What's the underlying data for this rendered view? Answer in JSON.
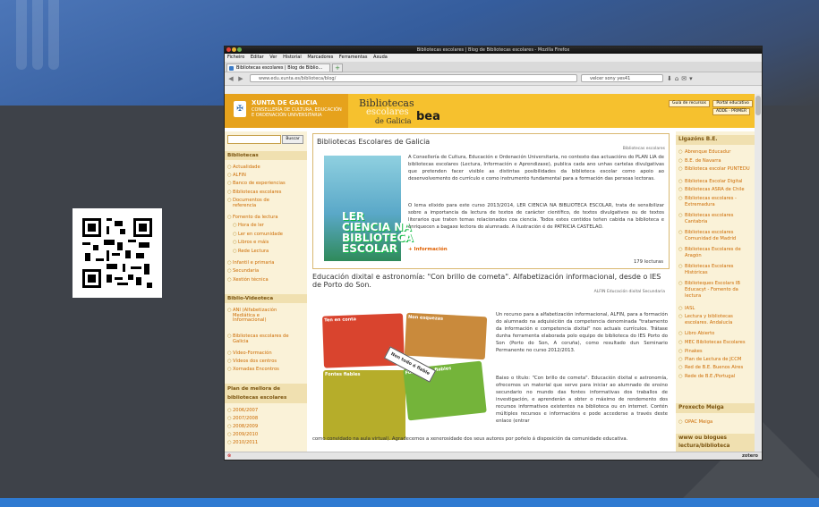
{
  "browser": {
    "title": "Bibliotecas escolares | Blog de Bibliotecas escolares - Mozilla Firefox",
    "menu": [
      "Ficheiro",
      "Editar",
      "Ver",
      "Historial",
      "Marcadores",
      "Ferramentas",
      "Axuda"
    ],
    "tab_label": "Bibliotecas escolares | Blog de Biblio...",
    "url": "www.edu.xunta.es/biblioteca/blog/",
    "search": "velcer sony yes41",
    "status_right": "zotero"
  },
  "header": {
    "xunta": "XUNTA DE GALICIA",
    "xunta_sub": "CONSELLERÍA DE CULTURA, EDUCACIÓN E ORDENACIÓN UNIVERSITARIA",
    "line1": "Bibliotecas",
    "line2": "escolares",
    "line3": "de Galicia",
    "logo": "bea",
    "btn_guide": "Guía de recursos",
    "btn_portal": "Portal educativo",
    "lang": "ADDE · PRIMER"
  },
  "left": {
    "search_button": "Buscar",
    "heading_bibliotecas": "Bibliotecas",
    "items": [
      "Actualidade",
      "ALFIN",
      "Banco de experiencias",
      "Bibliotecas escolares",
      "Documentos de referencia",
      "Fomento da lectura"
    ],
    "sub_items": [
      "Hora de ler",
      "Ler en comunidade",
      "Libros e máis",
      "Rede Lectura"
    ],
    "items2": [
      "Infantil e primaria",
      "Secundaria",
      "Xestión técnica"
    ],
    "heading_video": "Biblio-Videoteca",
    "video_items": [
      "ANI (Alfabetización Mediática e Informacional)",
      "Bibliotecas escolares de Galicia",
      "Vídeo-Formación",
      "Vídeos dos centros",
      "Xornadas Encontros"
    ],
    "heading_plan": "Plan de mellora de bibliotecas escolares",
    "years": [
      "2006/2007",
      "2007/2008",
      "2008/2009",
      "2009/2010",
      "2010/2011"
    ]
  },
  "main": {
    "box_title": "Bibliotecas Escolares de Galicia",
    "box_meta": "Bibliotecas escolares",
    "cover_text": "LER CIENCIA NA BIBLIOTECA ESCOLAR",
    "para1": "A Consellería de Cultura, Educación e Ordenación Universitaria, no contexto das actuacións do PLAN LIA de bibliotecas escolares (Lectura, Información e Aprendizaxe), publica cada ano unhas cartelas divulgativas que pretenden facer visible as distintas posibilidades da biblioteca escolar como apoio ao desenvolvemento do currículo e como instrumento fundamental para a formación das persoas lectoras.",
    "para2": "O lema elixido para este curso 2013/2014, LER CIENCIA NA BIBLIOTECA ESCOLAR, trata de sensibilizar sobre a importancia da lectura de textos de carácter científico, de textos divulgativos ou de textos literarios que traten temas relacionados coa ciencia. Todos estes contidos teñen cabida na biblioteca e enriquecen a bagaxe lectora do alumnado. A ilustración é de PATRICIA CASTELAO.",
    "more": "+ Información",
    "reads": "179 lecturas",
    "post_title": "Educación dixital e astronomía: \"Con brillo de cometa\". Alfabetización informacional, desde o IES de Porto do Son.",
    "post_meta": "ALFIN    Educación dixital    Secundaria",
    "infographic": {
      "c1": "Ten en conta",
      "c2": "Non esquezas",
      "c3": "Fontes fiables",
      "c4": "Fontes non fiables",
      "tag": "Non todo é fiable"
    },
    "para3": "Un recurso para a alfabetización informacional, ALFIN, para a formación do alumnado na adquisición da competencia denominada \"tratamento da información e competencia dixital\" nos actuais currículos. Trátase dunha ferramenta elaborada polo equipo de biblioteca do IES Porto do Son (Porto do Son, A coruña), como resultado dun Seminario Permanente no curso 2012/2013.",
    "para4": "Baixo o título: \"Con brillo de cometa\". Educación dixital e astronomía, ofrecemos un material que serve para iniciar ao alumnado de ensino secundario no mundo das fontes informativas dos traballos de investigación, e aprenderán a obter o máximo de rendemento dos recursos informativos existentes na biblioteca ou en internet. Contén múltiples recursos e informacións e pode accederse a través deste enlace (entrar",
    "tail": "como convidado na aula virtual). Agradecemos a xenerosidade dos seus autores por poñelo á disposición da comunidade educativa."
  },
  "right": {
    "heading_links": "Ligazóns B.E.",
    "links": [
      "Abrenque Educadur",
      "B.E. de Navarra",
      "Biblioteca escolar PUNTEDU",
      "Biblioteca Escolar Digital",
      "Bibliotecas ASRA de Chile",
      "Bibliotecas escolares - Extremadura",
      "Bibliotecas escolares Cantabria",
      "Bibliotecas escolares Comunidad de Madrid",
      "Bibliotecas Escolares de Aragón",
      "Bibliotecas Escolares Históricas",
      "Biblioteques Escolars IB Educacyt - Fomento da lectura",
      "IASL",
      "Lectura y bibliotecas escolares. Andalucía",
      "Libro Abierto",
      "MEC Bibliotecas Escolares",
      "Pinakes",
      "Plan de Lectura de JCCM",
      "Red de B.E. Buenos Aires",
      "Rede de B.E./Portugal"
    ],
    "heading_mega": "Proxecto Meiga",
    "mega": [
      "OPAC Meiga"
    ],
    "heading_blogs": "www ou blogues lectura/biblioteca"
  }
}
